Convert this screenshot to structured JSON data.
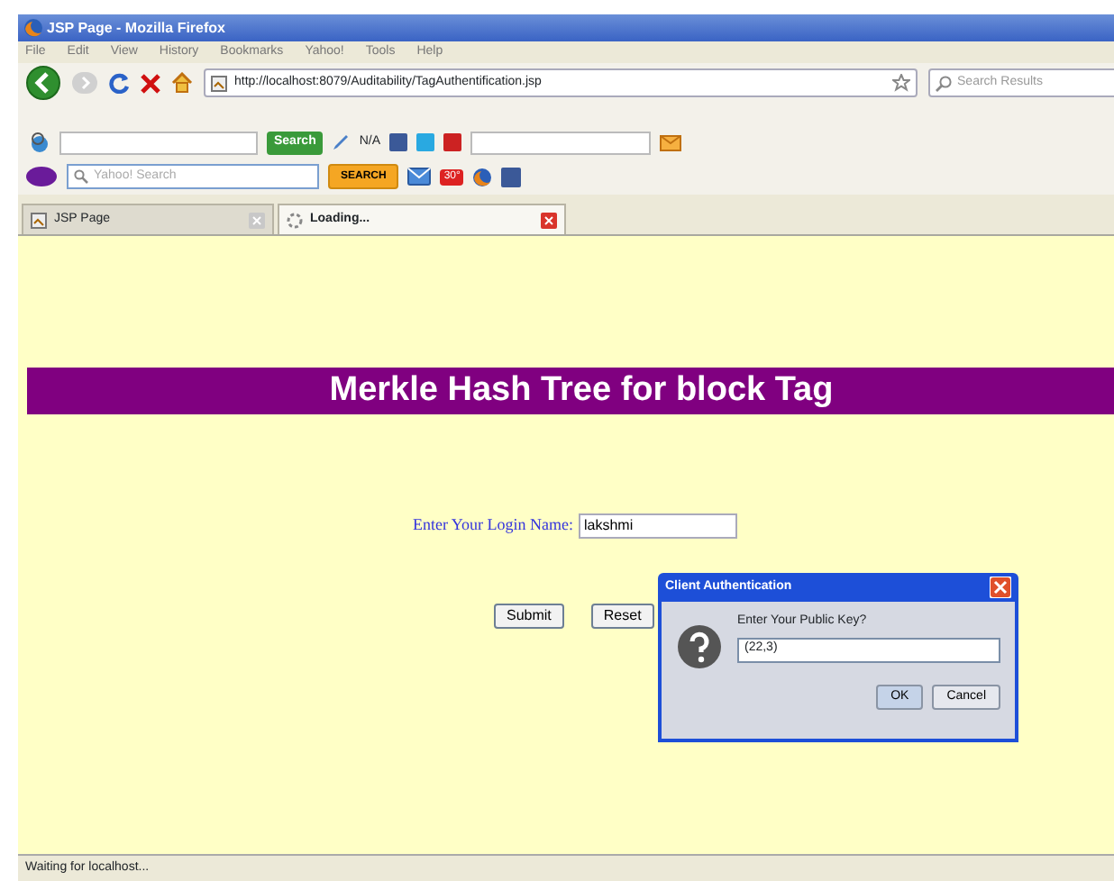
{
  "window": {
    "title": "JSP Page - Mozilla Firefox"
  },
  "menu": [
    "File",
    "Edit",
    "View",
    "History",
    "Bookmarks",
    "Yahoo!",
    "Tools",
    "Help"
  ],
  "nav": {
    "url": "http://localhost:8079/Auditability/TagAuthentification.jsp",
    "search_placeholder": "Search Results"
  },
  "toolbar": {
    "search_button": "Search",
    "rating": "N/A"
  },
  "yahoo_toolbar": {
    "search_placeholder": "Yahoo! Search",
    "search_button": "SEARCH",
    "weather": "30°"
  },
  "tabs": [
    {
      "label": "JSP Page",
      "kind": "page",
      "selected": false
    },
    {
      "label": "Loading...",
      "kind": "loading",
      "selected": true
    }
  ],
  "page": {
    "banner": "Merkle Hash Tree for block Tag",
    "login_label": "Enter Your Login Name:",
    "login_value": "lakshmi",
    "buttons": [
      "Submit",
      "Reset"
    ]
  },
  "dialog": {
    "title": "Client Authentication",
    "prompt": "Enter Your Public Key?",
    "value": "(22,3)",
    "buttons": [
      "OK",
      "Cancel"
    ]
  },
  "status_bar": {
    "text": "Waiting for localhost..."
  }
}
